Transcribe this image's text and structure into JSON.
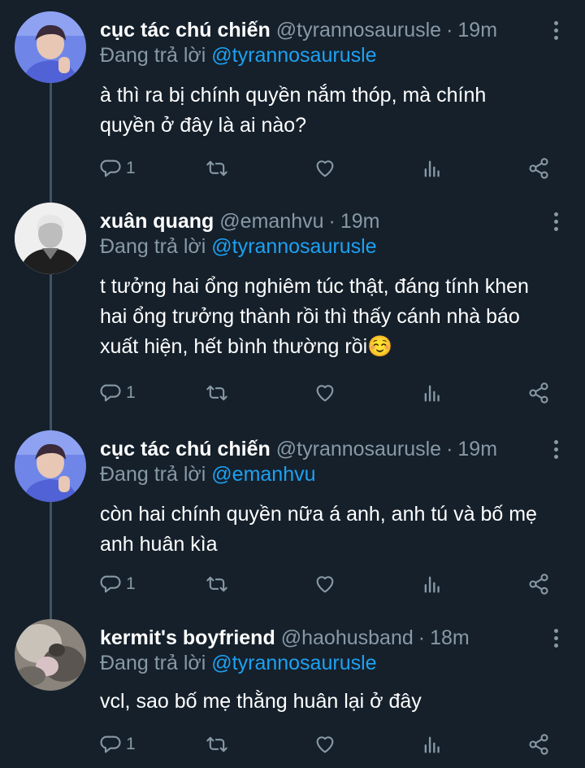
{
  "tweets": [
    {
      "name": "cục tác chú chiến",
      "handle": "@tyrannosaurusle",
      "dot": "·",
      "time": "19m",
      "reply_prefix": "Đang trả lời",
      "reply_to": "@tyrannosaurusle",
      "text_lines": [
        "à thì ra bị chính quyền nắm thóp, mà chính",
        "quyền ở đây là ai nào?"
      ],
      "reply_count": "1"
    },
    {
      "name": "xuân quang",
      "handle": "@emanhvu",
      "dot": "·",
      "time": "19m",
      "reply_prefix": "Đang trả lời",
      "reply_to": "@tyrannosaurusle",
      "text_lines": [
        "t tưởng hai ổng nghiêm túc thật, đáng tính khen",
        "hai ổng trưởng thành rồi thì thấy cánh nhà báo",
        "xuất hiện, hết bình thường rồi☺️"
      ],
      "reply_count": "1"
    },
    {
      "name": "cục tác chú chiến",
      "handle": "@tyrannosaurusle",
      "dot": "·",
      "time": "19m",
      "reply_prefix": "Đang trả lời",
      "reply_to": "@emanhvu",
      "text_lines": [
        "còn hai chính quyền nữa á anh, anh tú và bố mẹ",
        "anh huân kìa"
      ],
      "reply_count": "1"
    },
    {
      "name": "kermit's boyfriend",
      "handle": "@haohusband",
      "dot": "·",
      "time": "18m",
      "reply_prefix": "Đang trả lời",
      "reply_to": "@tyrannosaurusle",
      "text_lines": [
        "vcl, sao bố mẹ thằng huân lại ở đây"
      ],
      "reply_count": "1"
    }
  ],
  "icons": {
    "reply": "reply-icon",
    "retweet": "retweet-icon",
    "like": "like-icon",
    "analytics": "analytics-icon",
    "share": "share-icon",
    "more": "more-icon"
  },
  "colors": {
    "background": "#15202b",
    "secondary_text": "#8899a6",
    "link": "#1da1f2",
    "thread_line": "#3d5466"
  }
}
